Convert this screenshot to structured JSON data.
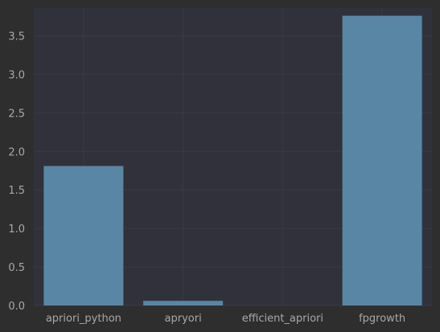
{
  "colors": {
    "page_background": "#2e2e2e",
    "plot_background": "#31313c",
    "grid": "#3a3a46",
    "bar": "#5a86a5",
    "tick_text": "#a8a8a8"
  },
  "chart_data": {
    "type": "bar",
    "title": "",
    "xlabel": "",
    "ylabel": "",
    "categories": [
      "apriori_python",
      "apryori",
      "efficient_apriori",
      "fpgrowth"
    ],
    "values": [
      1.81,
      0.06,
      0.0,
      3.76
    ],
    "ylim": [
      0,
      3.86
    ],
    "yticks": [
      0.0,
      0.5,
      1.0,
      1.5,
      2.0,
      2.5,
      3.0,
      3.5
    ],
    "ytick_labels": [
      "0.0",
      "0.5",
      "1.0",
      "1.5",
      "2.0",
      "2.5",
      "3.0",
      "3.5"
    ],
    "grid": true,
    "legend": "none"
  }
}
